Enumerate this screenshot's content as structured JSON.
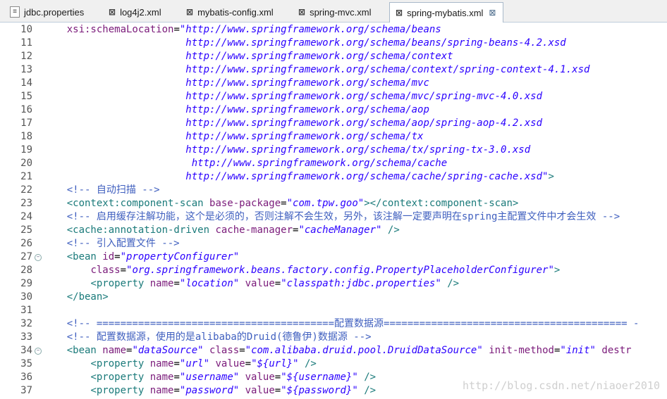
{
  "tabs": [
    {
      "label": "jdbc.properties",
      "icon": "properties-file-icon",
      "active": false
    },
    {
      "label": "log4j2.xml",
      "icon": "xml-file-icon",
      "active": false
    },
    {
      "label": "mybatis-config.xml",
      "icon": "xml-file-icon",
      "active": false
    },
    {
      "label": "spring-mvc.xml",
      "icon": "xml-file-icon",
      "active": false
    },
    {
      "label": "spring-mybatis.xml",
      "icon": "xml-file-icon",
      "active": true
    }
  ],
  "editor": {
    "lines": [
      {
        "num": "10",
        "tokens": [
          [
            "text",
            "    "
          ],
          [
            "attr",
            "xsi:schemaLocation"
          ],
          [
            "eq",
            "="
          ],
          [
            "val",
            "\"http://www.springframework.org/schema/beans"
          ]
        ]
      },
      {
        "num": "11",
        "tokens": [
          [
            "text",
            "                        "
          ],
          [
            "val",
            "http://www.springframework.org/schema/beans/spring-beans-4.2.xsd"
          ]
        ]
      },
      {
        "num": "12",
        "tokens": [
          [
            "text",
            "                        "
          ],
          [
            "val",
            "http://www.springframework.org/schema/context"
          ]
        ]
      },
      {
        "num": "13",
        "tokens": [
          [
            "text",
            "                        "
          ],
          [
            "val",
            "http://www.springframework.org/schema/context/spring-context-4.1.xsd"
          ]
        ]
      },
      {
        "num": "14",
        "tokens": [
          [
            "text",
            "                        "
          ],
          [
            "val",
            "http://www.springframework.org/schema/mvc"
          ]
        ]
      },
      {
        "num": "15",
        "tokens": [
          [
            "text",
            "                        "
          ],
          [
            "val",
            "http://www.springframework.org/schema/mvc/spring-mvc-4.0.xsd"
          ]
        ]
      },
      {
        "num": "16",
        "tokens": [
          [
            "text",
            "                        "
          ],
          [
            "val",
            "http://www.springframework.org/schema/aop"
          ]
        ]
      },
      {
        "num": "17",
        "tokens": [
          [
            "text",
            "                        "
          ],
          [
            "val",
            "http://www.springframework.org/schema/aop/spring-aop-4.2.xsd"
          ]
        ]
      },
      {
        "num": "18",
        "tokens": [
          [
            "text",
            "                        "
          ],
          [
            "val",
            "http://www.springframework.org/schema/tx"
          ]
        ]
      },
      {
        "num": "19",
        "tokens": [
          [
            "text",
            "                        "
          ],
          [
            "val",
            "http://www.springframework.org/schema/tx/spring-tx-3.0.xsd"
          ]
        ]
      },
      {
        "num": "20",
        "tokens": [
          [
            "text",
            "                         "
          ],
          [
            "val",
            "http://www.springframework.org/schema/cache"
          ]
        ]
      },
      {
        "num": "21",
        "tokens": [
          [
            "text",
            "                        "
          ],
          [
            "val",
            "http://www.springframework.org/schema/cache/spring-cache.xsd\""
          ],
          [
            "tag",
            ">"
          ]
        ]
      },
      {
        "num": "22",
        "tokens": [
          [
            "text",
            "    "
          ],
          [
            "com",
            "<!-- 自动扫描 -->"
          ]
        ]
      },
      {
        "num": "23",
        "tokens": [
          [
            "text",
            "    "
          ],
          [
            "tag",
            "<context:component-scan "
          ],
          [
            "attr",
            "base-package"
          ],
          [
            "eq",
            "="
          ],
          [
            "val",
            "\"com.tpw.goo\""
          ],
          [
            "tag",
            "></context:component-scan>"
          ]
        ]
      },
      {
        "num": "24",
        "tokens": [
          [
            "text",
            "    "
          ],
          [
            "com",
            "<!-- 启用缓存注解功能，这个是必须的，否则注解不会生效，另外，该注解一定要声明在spring主配置文件中才会生效 -->"
          ]
        ]
      },
      {
        "num": "25",
        "tokens": [
          [
            "text",
            "    "
          ],
          [
            "tag",
            "<cache:annotation-driven "
          ],
          [
            "attr",
            "cache-manager"
          ],
          [
            "eq",
            "="
          ],
          [
            "val",
            "\"cacheManager\""
          ],
          [
            "tag",
            " />"
          ]
        ]
      },
      {
        "num": "26",
        "tokens": [
          [
            "text",
            "    "
          ],
          [
            "com",
            "<!-- 引入配置文件 -->"
          ]
        ]
      },
      {
        "num": "27",
        "fold": true,
        "tokens": [
          [
            "text",
            "    "
          ],
          [
            "tag",
            "<bean "
          ],
          [
            "attr",
            "id"
          ],
          [
            "eq",
            "="
          ],
          [
            "val",
            "\"propertyConfigurer\""
          ]
        ]
      },
      {
        "num": "28",
        "tokens": [
          [
            "text",
            "        "
          ],
          [
            "attr",
            "class"
          ],
          [
            "eq",
            "="
          ],
          [
            "val",
            "\"org.springframework.beans.factory.config.PropertyPlaceholderConfigurer\""
          ],
          [
            "tag",
            ">"
          ]
        ]
      },
      {
        "num": "29",
        "tokens": [
          [
            "text",
            "        "
          ],
          [
            "tag",
            "<property "
          ],
          [
            "attr",
            "name"
          ],
          [
            "eq",
            "="
          ],
          [
            "val",
            "\"location\""
          ],
          [
            "text",
            " "
          ],
          [
            "attr",
            "value"
          ],
          [
            "eq",
            "="
          ],
          [
            "val",
            "\"classpath:jdbc.properties\""
          ],
          [
            "tag",
            " />"
          ]
        ]
      },
      {
        "num": "30",
        "tokens": [
          [
            "text",
            "    "
          ],
          [
            "tag",
            "</bean>"
          ]
        ]
      },
      {
        "num": "31",
        "tokens": []
      },
      {
        "num": "32",
        "tokens": [
          [
            "text",
            "    "
          ],
          [
            "com",
            "<!-- ========================================配置数据源========================================= -"
          ]
        ]
      },
      {
        "num": "33",
        "tokens": [
          [
            "text",
            "    "
          ],
          [
            "com",
            "<!-- 配置数据源，使用的是alibaba的Druid(德鲁伊)数据源 -->"
          ]
        ]
      },
      {
        "num": "34",
        "fold": true,
        "tokens": [
          [
            "text",
            "    "
          ],
          [
            "tag",
            "<bean "
          ],
          [
            "attr",
            "name"
          ],
          [
            "eq",
            "="
          ],
          [
            "val",
            "\"dataSource\""
          ],
          [
            "text",
            " "
          ],
          [
            "attr",
            "class"
          ],
          [
            "eq",
            "="
          ],
          [
            "val",
            "\"com.alibaba.druid.pool.DruidDataSource\""
          ],
          [
            "text",
            " "
          ],
          [
            "attr",
            "init-method"
          ],
          [
            "eq",
            "="
          ],
          [
            "val",
            "\"init\""
          ],
          [
            "text",
            " "
          ],
          [
            "attr",
            "destr"
          ]
        ]
      },
      {
        "num": "35",
        "tokens": [
          [
            "text",
            "        "
          ],
          [
            "tag",
            "<property "
          ],
          [
            "attr",
            "name"
          ],
          [
            "eq",
            "="
          ],
          [
            "val",
            "\"url\""
          ],
          [
            "text",
            " "
          ],
          [
            "attr",
            "value"
          ],
          [
            "eq",
            "="
          ],
          [
            "val",
            "\"${url}\""
          ],
          [
            "tag",
            " />"
          ]
        ]
      },
      {
        "num": "36",
        "tokens": [
          [
            "text",
            "        "
          ],
          [
            "tag",
            "<property "
          ],
          [
            "attr",
            "name"
          ],
          [
            "eq",
            "="
          ],
          [
            "val",
            "\"username\""
          ],
          [
            "text",
            " "
          ],
          [
            "attr",
            "value"
          ],
          [
            "eq",
            "="
          ],
          [
            "val",
            "\"${username}\""
          ],
          [
            "tag",
            " />"
          ]
        ]
      },
      {
        "num": "37",
        "tokens": [
          [
            "text",
            "        "
          ],
          [
            "tag",
            "<property "
          ],
          [
            "attr",
            "name"
          ],
          [
            "eq",
            "="
          ],
          [
            "val",
            "\"password\""
          ],
          [
            "text",
            " "
          ],
          [
            "attr",
            "value"
          ],
          [
            "eq",
            "="
          ],
          [
            "val",
            "\"${password}\""
          ],
          [
            "tag",
            " />"
          ]
        ]
      }
    ]
  },
  "watermark": "http://blog.csdn.net/niaoer2010"
}
